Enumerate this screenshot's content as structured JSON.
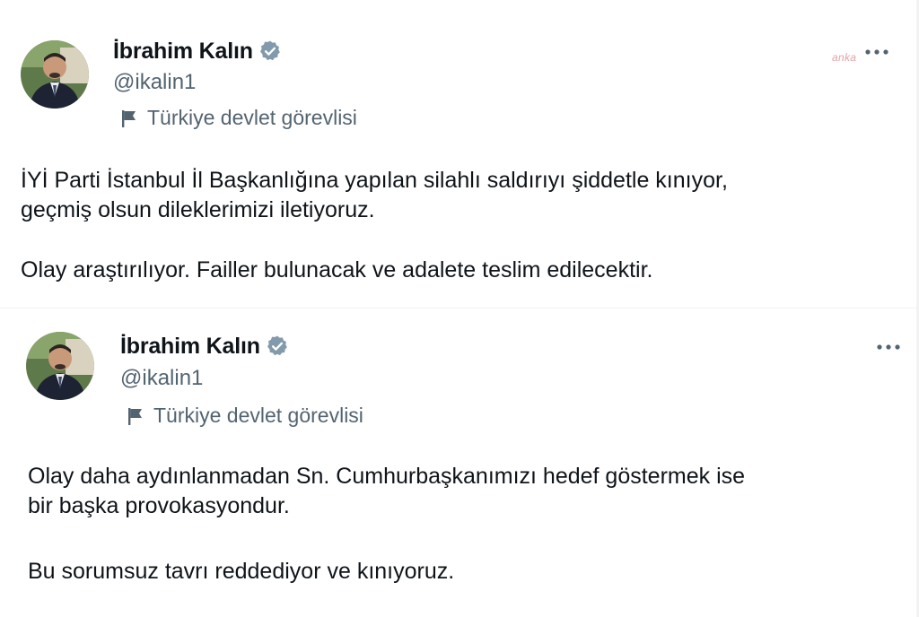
{
  "tweets": [
    {
      "author": {
        "display_name": "İbrahim Kalın",
        "handle": "@ikalin1",
        "verified_icon": "verified-badge-icon",
        "affiliation": "Türkiye devlet görevlisi",
        "affiliation_icon": "flag-icon"
      },
      "more_icon": "more-options-icon",
      "watermark": "anka",
      "paragraphs": [
        [
          "İYİ Parti İstanbul İl Başkanlığına yapılan silahlı saldırıyı şiddetle kınıyor,",
          "geçmiş olsun dileklerimizi iletiyoruz."
        ],
        [
          "Olay araştırılıyor. Failler bulunacak ve adalete teslim edilecektir."
        ]
      ]
    },
    {
      "author": {
        "display_name": "İbrahim Kalın",
        "handle": "@ikalin1",
        "verified_icon": "verified-badge-icon",
        "affiliation": "Türkiye devlet görevlisi",
        "affiliation_icon": "flag-icon"
      },
      "more_icon": "more-options-icon",
      "paragraphs": [
        [
          "Olay daha aydınlanmadan Sn. Cumhurbaşkanımızı hedef göstermek ise",
          "bir başka provokasyondur."
        ],
        [
          "Bu sorumsuz tavrı reddediyor ve kınıyoruz."
        ]
      ]
    }
  ],
  "colors": {
    "text_primary": "#0f1419",
    "text_secondary": "#536471",
    "verified_badge": "#829aab",
    "divider": "#eff3f4"
  }
}
